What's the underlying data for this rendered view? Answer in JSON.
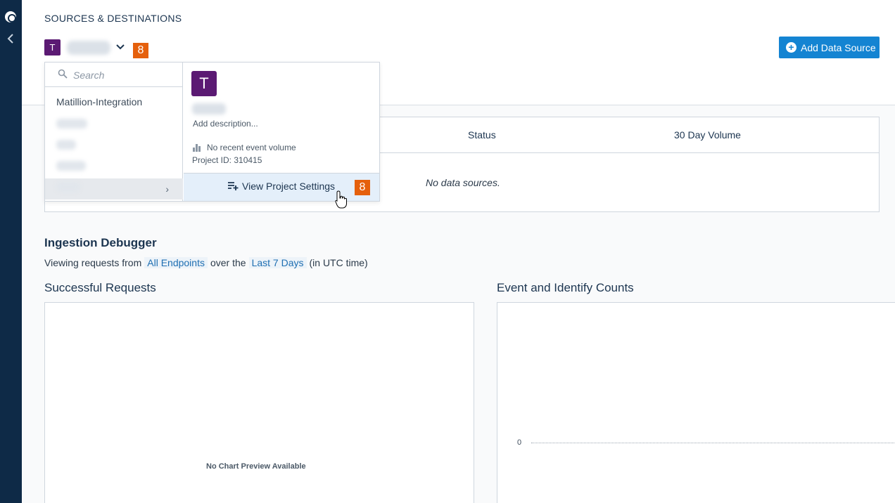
{
  "header": {
    "eyebrow": "SOURCES & DESTINATIONS",
    "project_initial": "T",
    "badge": "8",
    "add_button": "Add Data Source"
  },
  "dropdown": {
    "search_placeholder": "Search",
    "items": [
      {
        "label": "Matillion-Integration"
      },
      {
        "label": ""
      },
      {
        "label": ""
      },
      {
        "label": ""
      },
      {
        "label": ""
      }
    ],
    "detail": {
      "initial": "T",
      "description": "Add description...",
      "volume": "No recent event volume",
      "project_id": "Project ID: 310415",
      "settings_label": "View Project Settings",
      "badge": "8"
    }
  },
  "table": {
    "columns": [
      "Status",
      "30 Day Volume"
    ],
    "empty": "No data sources."
  },
  "ingestion": {
    "title": "Ingestion Debugger",
    "prefix": "Viewing requests from",
    "endpoints": "All Endpoints",
    "middle": "over the",
    "range": "Last 7 Days",
    "suffix": "(in UTC time)"
  },
  "charts": {
    "left_title": "Successful Requests",
    "left_empty": "No Chart Preview Available",
    "right_title": "Event and Identify Counts",
    "right_axis_zero": "0"
  }
}
